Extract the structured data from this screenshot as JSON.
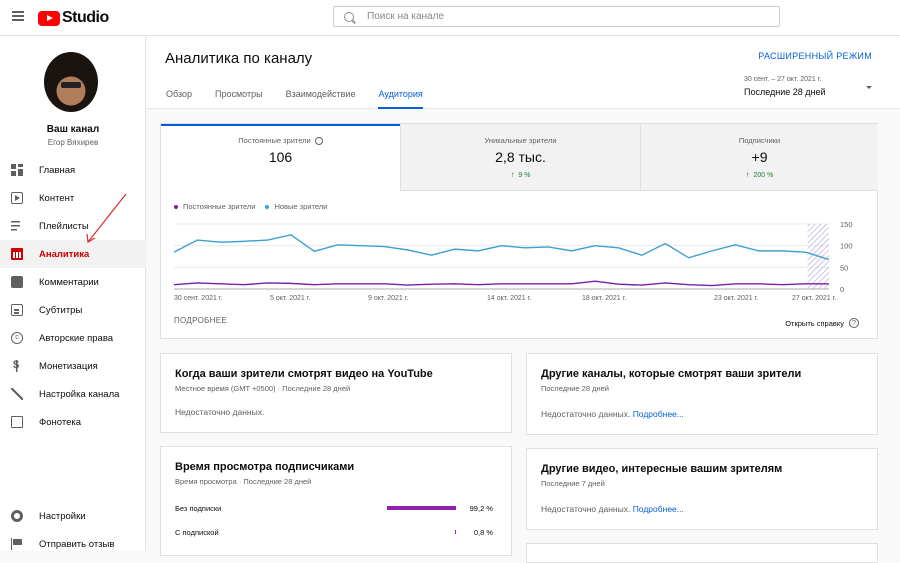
{
  "topbar": {
    "logo_text": "Studio",
    "search_placeholder": "Поиск на канале"
  },
  "sidebar": {
    "channel_name": "Ваш канал",
    "channel_owner": "Егор Вяхирев",
    "items": [
      {
        "label": "Главная",
        "icon": "dashboard-icon"
      },
      {
        "label": "Контент",
        "icon": "content-icon"
      },
      {
        "label": "Плейлисты",
        "icon": "playlist-icon"
      },
      {
        "label": "Аналитика",
        "icon": "analytics-icon",
        "active": true
      },
      {
        "label": "Комментарии",
        "icon": "comments-icon"
      },
      {
        "label": "Субтитры",
        "icon": "subtitles-icon"
      },
      {
        "label": "Авторские права",
        "icon": "copyright-icon"
      },
      {
        "label": "Монетизация",
        "icon": "monetization-icon"
      },
      {
        "label": "Настройка канала",
        "icon": "customization-icon"
      },
      {
        "label": "Фонотека",
        "icon": "audio-library-icon"
      }
    ],
    "bottom_items": [
      {
        "label": "Настройки",
        "icon": "settings-icon"
      },
      {
        "label": "Отправить отзыв",
        "icon": "feedback-icon"
      }
    ]
  },
  "header": {
    "title": "Аналитика по каналу",
    "advanced_mode": "РАСШИРЕННЫЙ РЕЖИМ",
    "tabs": [
      "Обзор",
      "Просмотры",
      "Взаимодействие",
      "Аудитория"
    ],
    "active_tab": "Аудитория",
    "date_range_top": "30 сент. – 27 окт. 2021 г.",
    "date_range_label": "Последние 28 дней"
  },
  "metrics": [
    {
      "label": "Постоянные зрители",
      "value": "106",
      "delta": ""
    },
    {
      "label": "Уникальные зрители",
      "value": "2,8 тыс.",
      "delta": "9 %"
    },
    {
      "label": "Подписчики",
      "value": "+9",
      "delta": "200 %"
    }
  ],
  "chart_data": {
    "type": "line",
    "legend": [
      "Постоянные зрители",
      "Новые зрители"
    ],
    "colors": {
      "returning": "#7b1fa2",
      "new": "#3d9fd1"
    },
    "x_labels": [
      "30 сент. 2021 г.",
      "5 окт. 2021 г.",
      "9 окт. 2021 г.",
      "14 окт. 2021 г.",
      "18 окт. 2021 г.",
      "23 окт. 2021 г.",
      "27 окт. 2021 г."
    ],
    "y_ticks": [
      "150",
      "100",
      "50",
      "0"
    ],
    "ylim": [
      0,
      150
    ],
    "series": [
      {
        "name": "Новые зрители",
        "values": [
          85,
          113,
          108,
          110,
          113,
          125,
          87,
          102,
          100,
          98,
          90,
          78,
          92,
          88,
          100,
          95,
          97,
          88,
          100,
          95,
          78,
          105,
          72,
          88,
          102,
          88,
          88,
          85,
          68
        ]
      },
      {
        "name": "Постоянные зрители",
        "values": [
          10,
          14,
          12,
          10,
          14,
          13,
          10,
          12,
          12,
          12,
          9,
          11,
          12,
          10,
          12,
          12,
          12,
          12,
          18,
          11,
          9,
          14,
          10,
          8,
          12,
          12,
          10,
          12,
          12
        ]
      }
    ],
    "more_link": "ПОДРОБНЕЕ",
    "help_link": "Открыть справку"
  },
  "cards": {
    "when_watch": {
      "title": "Когда ваши зрители смотрят видео на YouTube",
      "subtitle": "Местное время (GMT +0500) · Последние 28 дней",
      "body": "Недостаточно данных."
    },
    "other_channels": {
      "title": "Другие каналы, которые смотрят ваши зрители",
      "subtitle": "Последние 28 дней",
      "body": "Недостаточно данных.",
      "link": "Подробнее..."
    },
    "sub_watch_time": {
      "title": "Время просмотра подписчиками",
      "subtitle": "Время просмотра · Последние 28 дней",
      "rows": [
        {
          "label": "Без подписки",
          "value": "99,2 %",
          "fraction": 0.992
        },
        {
          "label": "С подпиской",
          "value": "0,8 %",
          "fraction": 0.008
        }
      ]
    },
    "other_videos": {
      "title": "Другие видео, интересные вашим зрителям",
      "subtitle": "Последние 7 дней",
      "body": "Недостаточно данных.",
      "link": "Подробнее..."
    }
  }
}
